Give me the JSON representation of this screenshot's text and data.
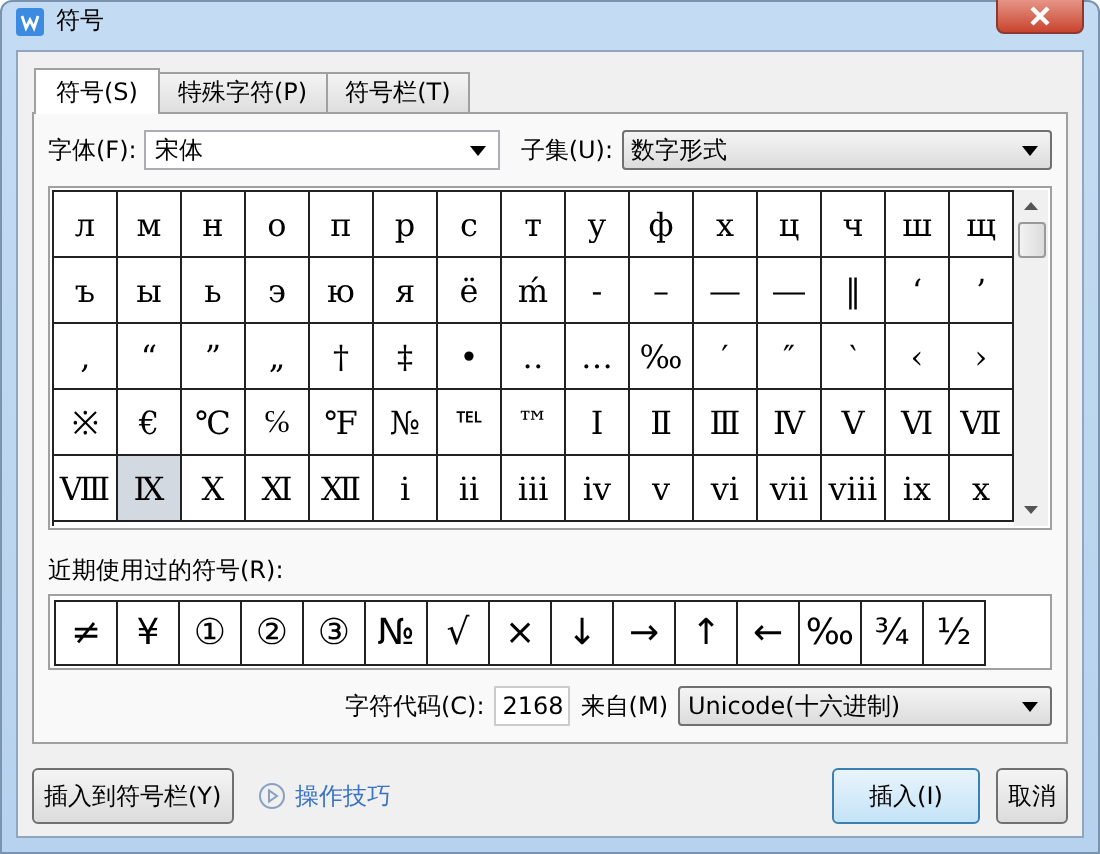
{
  "window": {
    "title": "符号"
  },
  "tabs": [
    {
      "label": "符号(S)",
      "selected": true
    },
    {
      "label": "特殊字符(P)",
      "selected": false
    },
    {
      "label": "符号栏(T)",
      "selected": false
    }
  ],
  "font": {
    "label": "字体(F):",
    "value": "宋体"
  },
  "subset": {
    "label": "子集(U):",
    "value": "数字形式"
  },
  "symbols": [
    [
      {
        "char": "л",
        "selected": false
      },
      {
        "char": "м",
        "selected": false
      },
      {
        "char": "н",
        "selected": false
      },
      {
        "char": "о",
        "selected": false
      },
      {
        "char": "п",
        "selected": false
      },
      {
        "char": "р",
        "selected": false
      },
      {
        "char": "с",
        "selected": false
      },
      {
        "char": "т",
        "selected": false
      },
      {
        "char": "у",
        "selected": false
      },
      {
        "char": "ф",
        "selected": false
      },
      {
        "char": "х",
        "selected": false
      },
      {
        "char": "ц",
        "selected": false
      },
      {
        "char": "ч",
        "selected": false
      },
      {
        "char": "ш",
        "selected": false
      },
      {
        "char": "щ",
        "selected": false
      }
    ],
    [
      {
        "char": "ъ",
        "selected": false
      },
      {
        "char": "ы",
        "selected": false
      },
      {
        "char": "ь",
        "selected": false
      },
      {
        "char": "э",
        "selected": false
      },
      {
        "char": "ю",
        "selected": false
      },
      {
        "char": "я",
        "selected": false
      },
      {
        "char": "ё",
        "selected": false
      },
      {
        "char": "ḿ",
        "selected": false
      },
      {
        "char": "‐",
        "selected": false
      },
      {
        "char": "–",
        "selected": false
      },
      {
        "char": "—",
        "selected": false
      },
      {
        "char": "―",
        "selected": false
      },
      {
        "char": "‖",
        "selected": false
      },
      {
        "char": "‘",
        "selected": false
      },
      {
        "char": "’",
        "selected": false
      }
    ],
    [
      {
        "char": "‚",
        "selected": false
      },
      {
        "char": "“",
        "selected": false
      },
      {
        "char": "”",
        "selected": false
      },
      {
        "char": "„",
        "selected": false
      },
      {
        "char": "†",
        "selected": false
      },
      {
        "char": "‡",
        "selected": false
      },
      {
        "char": "•",
        "selected": false
      },
      {
        "char": "‥",
        "selected": false
      },
      {
        "char": "…",
        "selected": false
      },
      {
        "char": "‰",
        "selected": false
      },
      {
        "char": "′",
        "selected": false
      },
      {
        "char": "″",
        "selected": false
      },
      {
        "char": "‵",
        "selected": false
      },
      {
        "char": "‹",
        "selected": false
      },
      {
        "char": "›",
        "selected": false
      }
    ],
    [
      {
        "char": "※",
        "selected": false
      },
      {
        "char": "€",
        "selected": false
      },
      {
        "char": "℃",
        "selected": false
      },
      {
        "char": "℅",
        "selected": false
      },
      {
        "char": "℉",
        "selected": false
      },
      {
        "char": "№",
        "selected": false
      },
      {
        "char": "℡",
        "selected": false
      },
      {
        "char": "™",
        "selected": false
      },
      {
        "char": "Ⅰ",
        "selected": false
      },
      {
        "char": "Ⅱ",
        "selected": false
      },
      {
        "char": "Ⅲ",
        "selected": false
      },
      {
        "char": "Ⅳ",
        "selected": false
      },
      {
        "char": "Ⅴ",
        "selected": false
      },
      {
        "char": "Ⅵ",
        "selected": false
      },
      {
        "char": "Ⅶ",
        "selected": false
      }
    ],
    [
      {
        "char": "Ⅷ",
        "selected": false
      },
      {
        "char": "Ⅸ",
        "selected": true
      },
      {
        "char": "Ⅹ",
        "selected": false
      },
      {
        "char": "Ⅺ",
        "selected": false
      },
      {
        "char": "Ⅻ",
        "selected": false
      },
      {
        "char": "ⅰ",
        "selected": false
      },
      {
        "char": "ⅱ",
        "selected": false
      },
      {
        "char": "ⅲ",
        "selected": false
      },
      {
        "char": "ⅳ",
        "selected": false
      },
      {
        "char": "ⅴ",
        "selected": false
      },
      {
        "char": "ⅵ",
        "selected": false
      },
      {
        "char": "ⅶ",
        "selected": false
      },
      {
        "char": "ⅷ",
        "selected": false
      },
      {
        "char": "ⅸ",
        "selected": false
      },
      {
        "char": "ⅹ",
        "selected": false
      }
    ]
  ],
  "recent": {
    "label": "近期使用过的符号(R):",
    "symbols": [
      "≠",
      "¥",
      "①",
      "②",
      "③",
      "№",
      "√",
      "×",
      "↓",
      "→",
      "↑",
      "←",
      "‰",
      "¾",
      "½"
    ]
  },
  "char_code": {
    "label": "字符代码(C):",
    "value": "2168"
  },
  "from": {
    "label": "来自(M)",
    "value": "Unicode(十六进制)"
  },
  "buttons": [
    {
      "label": "插入到符号栏(Y)",
      "kind": "plain"
    },
    {
      "label": "操作技巧",
      "kind": "link"
    },
    {
      "label": "插入(I)",
      "kind": "default"
    },
    {
      "label": "取消",
      "kind": "plain"
    }
  ]
}
